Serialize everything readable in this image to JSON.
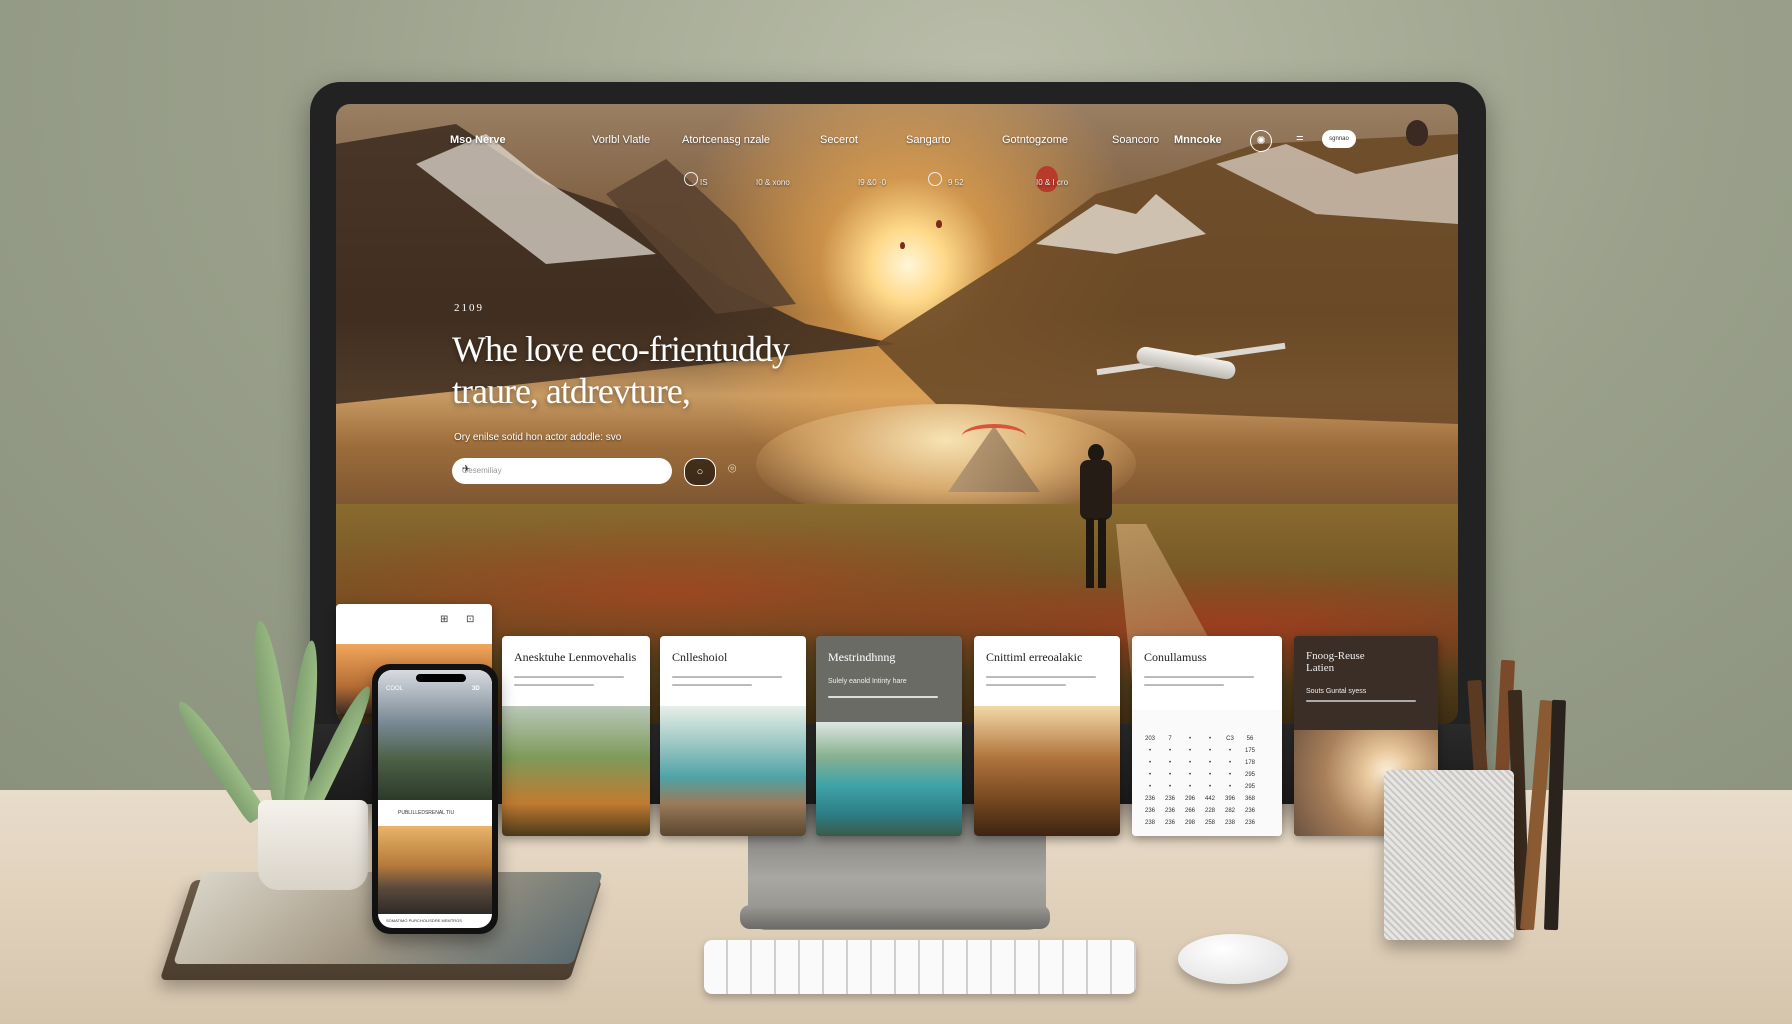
{
  "nav": {
    "brand": "Mso Nerve",
    "items": [
      "Vorlbl Vlatle",
      "Atortcenasg nzale",
      "Secerot",
      "Sangarto",
      "Gotntogzome",
      "Soancoro",
      "Mnncoke"
    ],
    "pill_label": "sgnnao"
  },
  "subbar": [
    "IS",
    "I0 &  xono",
    "I9 &0  ·0",
    "9 52",
    "I0 & I   cro"
  ],
  "hero": {
    "date": "2109",
    "headline_line1": "Whe love eco-frientuddy",
    "headline_line2": "traure, atdrevture,",
    "tagline": "Ory enilse sotid hon actor adodle: svo",
    "search_placeholder": "Oesemiliay"
  },
  "cards": [
    {
      "title": "Anesktuhe Lenmovehalis"
    },
    {
      "title": "Cnlleshoiol"
    },
    {
      "title": "Mestrindhnng",
      "subtitle": "Sulely eanold Intinty hare"
    },
    {
      "title": "Cnittiml erreoalakic"
    },
    {
      "title": "Conullamuss"
    },
    {
      "title": "Fnoog-Reuse Latien",
      "subtitle": "Souts Guntal syess"
    }
  ],
  "calendar": {
    "header": [
      "203",
      "7",
      "",
      "",
      "C3",
      "56"
    ],
    "rows": [
      [
        "",
        "",
        "",
        "",
        "",
        "175"
      ],
      [
        "",
        "",
        "",
        "",
        "",
        "178"
      ],
      [
        "",
        "",
        "",
        "",
        "",
        "295"
      ],
      [
        "",
        "",
        "",
        "",
        "",
        "295"
      ],
      [
        "236",
        "236",
        "296",
        "442",
        "396",
        "368"
      ],
      [
        "236",
        "236",
        "266",
        "228",
        "282",
        "236"
      ],
      [
        "238",
        "236",
        "298",
        "258",
        "238",
        "236"
      ]
    ]
  },
  "phone": {
    "top_label": "COOL",
    "top_num": "3D",
    "mid_label": "PUBLILLEDSRENAL TIU",
    "bottom_label": "SOMATIMO PURCHOLISDRE MEMTROS"
  },
  "colors": {
    "accent": "#d9553a",
    "screen_dark": "#222222"
  }
}
